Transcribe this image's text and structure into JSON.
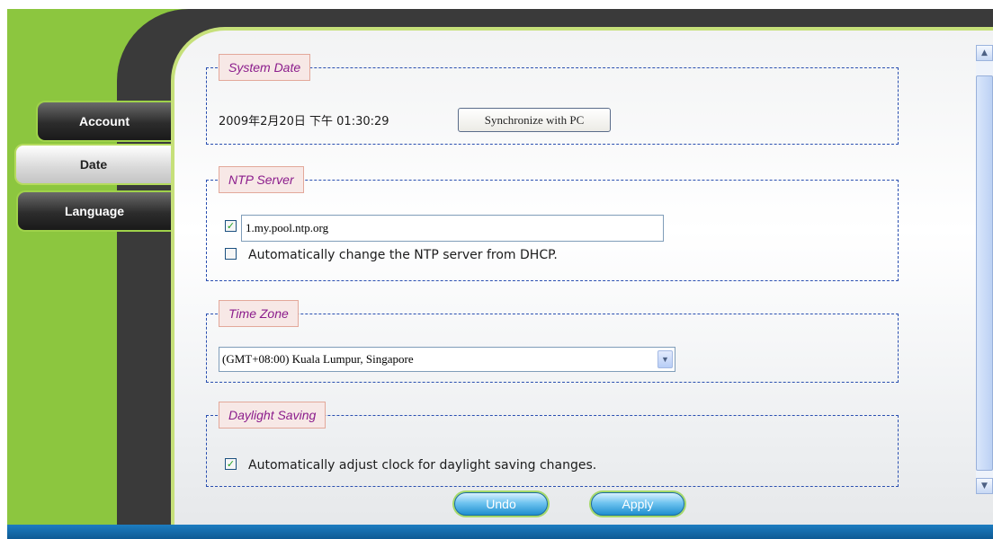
{
  "tabs": {
    "account": "Account",
    "date": "Date",
    "language": "Language"
  },
  "system_date": {
    "legend": "System Date",
    "datetime": "2009年2月20日 下午 01:30:29",
    "sync_button": "Synchronize with PC"
  },
  "ntp": {
    "legend": "NTP Server",
    "server_enabled": true,
    "server_value": "1.my.pool.ntp.org",
    "dhcp_checked": false,
    "dhcp_label": "Automatically change the NTP server from DHCP."
  },
  "timezone": {
    "legend": "Time Zone",
    "selected": "(GMT+08:00) Kuala Lumpur, Singapore"
  },
  "daylight": {
    "legend": "Daylight Saving",
    "checked": true,
    "label": "Automatically adjust clock for daylight saving changes."
  },
  "actions": {
    "undo": "Undo",
    "apply": "Apply"
  },
  "colors": {
    "accent_green": "#8cc63f",
    "legend_text": "#8b1c8c",
    "fieldset_border": "#2a4fb0",
    "button_blue": "#1f8fcf"
  }
}
